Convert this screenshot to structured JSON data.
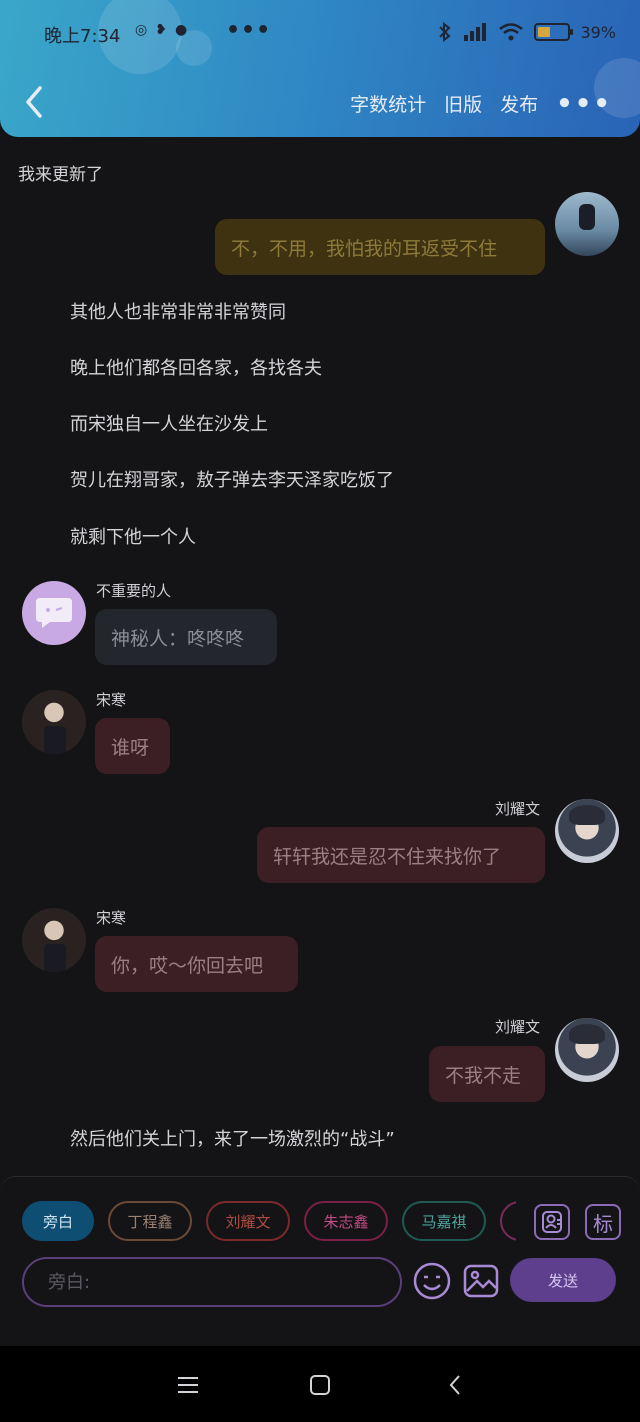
{
  "status_bar": {
    "time": "晚上7:34",
    "battery_percent": "39%",
    "battery_level": 0.39
  },
  "header": {
    "actions": [
      "字数统计",
      "旧版",
      "发布"
    ]
  },
  "chat": {
    "top_note": "我来更新了",
    "top_bubble": "不，不用，我怕我的耳返受不住",
    "narrations": [
      "其他人也非常非常非常赞同",
      "晚上他们都各回各家，各找各夫",
      "而宋独自一人坐在沙发上",
      "贺儿在翔哥家，敖子弹去李天泽家吃饭了",
      "就剩下他一个人"
    ],
    "messages": [
      {
        "name": "不重要的人",
        "text": "神秘人：咚咚咚"
      },
      {
        "name": "宋寒",
        "text": "谁呀"
      },
      {
        "name": "刘耀文",
        "text": "轩轩我还是忍不住来找你了"
      },
      {
        "name": "宋寒",
        "text": "你，哎～你回去吧"
      },
      {
        "name": "刘耀文",
        "text": "不我不走"
      }
    ],
    "final_narration": "然后他们关上门，来了一场激烈的“战斗”"
  },
  "input_panel": {
    "chips": [
      "旁白",
      "丁程鑫",
      "刘耀文",
      "朱志鑫",
      "马嘉祺"
    ],
    "tag_button": "标",
    "input_placeholder": "旁白:",
    "send_label": "发送"
  },
  "colors": {
    "header_gradient_start": "#3aa7c9",
    "header_gradient_end": "#2a63b6",
    "background": "#141416",
    "send_button": "#5e3f8e"
  }
}
